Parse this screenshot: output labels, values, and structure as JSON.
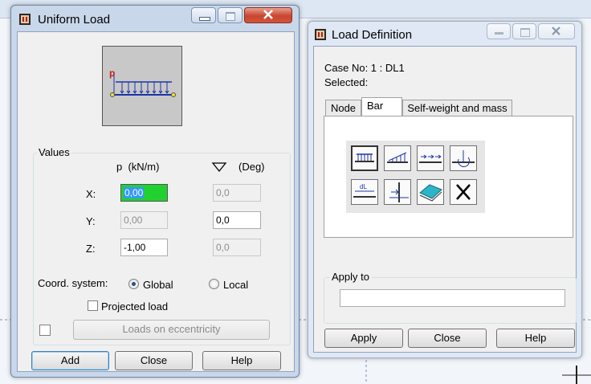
{
  "uniform_load": {
    "title": "Uniform Load",
    "preview_label": "p",
    "values_group": "Values",
    "p_header": "p  (kN/m)",
    "deg_header": "(Deg)",
    "rows": [
      {
        "axis": "X:",
        "p": "0,00",
        "deg": "0,0"
      },
      {
        "axis": "Y:",
        "p": "0,00",
        "deg": "0,0"
      },
      {
        "axis": "Z:",
        "p": "-1,00",
        "deg": "0,0"
      }
    ],
    "coord_label": "Coord. system:",
    "global_label": "Global",
    "local_label": "Local",
    "coord_selected": "Global",
    "projected_label": "Projected load",
    "eccentricity_label": "Loads on eccentricity",
    "add_label": "Add",
    "close_label": "Close",
    "help_label": "Help"
  },
  "load_definition": {
    "title": "Load Definition",
    "case_no": "Case No: 1 : DL1",
    "selected": "Selected:",
    "tabs": [
      "Node",
      "Bar",
      "Self-weight and mass"
    ],
    "active_tab": "Bar",
    "tool_icons": [
      "uniform-load-icon",
      "trapezoidal-load-icon",
      "concentrated-forces-icon",
      "moment-load-icon",
      "dl-load-icon",
      "force-on-bar-icon",
      "surface-load-icon",
      "delete-load-icon"
    ],
    "apply_to_label": "Apply to",
    "apply_to_value": "",
    "apply_label": "Apply",
    "close_label": "Close",
    "help_label": "Help"
  },
  "colors": {
    "highlight_field": "#22d12f",
    "selection": "#3399ff"
  }
}
